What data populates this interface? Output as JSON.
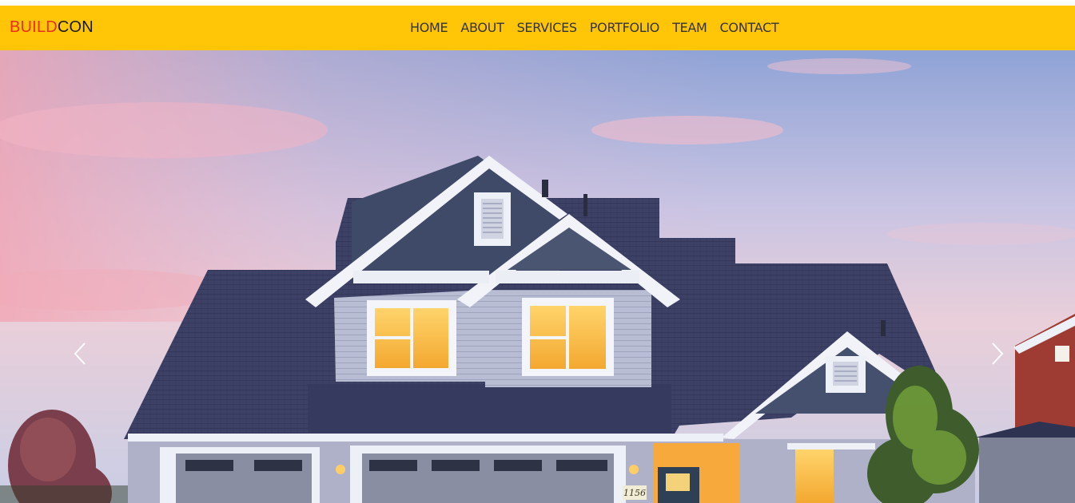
{
  "brand": {
    "part_one": "BUILD",
    "part_two": "CON"
  },
  "nav": {
    "items": [
      {
        "label": "HOME"
      },
      {
        "label": "ABOUT"
      },
      {
        "label": "SERVICES"
      },
      {
        "label": "PORTFOLIO"
      },
      {
        "label": "TEAM"
      },
      {
        "label": "CONTACT"
      }
    ]
  },
  "hero": {
    "image_subject": "house-at-dusk",
    "house_number": "1156",
    "prev_icon": "chevron-left-icon",
    "next_icon": "chevron-right-icon"
  },
  "colors": {
    "navbar_bg": "#ffc506",
    "brand_accent": "#e8301c",
    "brand_dark": "#1a1a1a",
    "nav_text": "#333333"
  }
}
